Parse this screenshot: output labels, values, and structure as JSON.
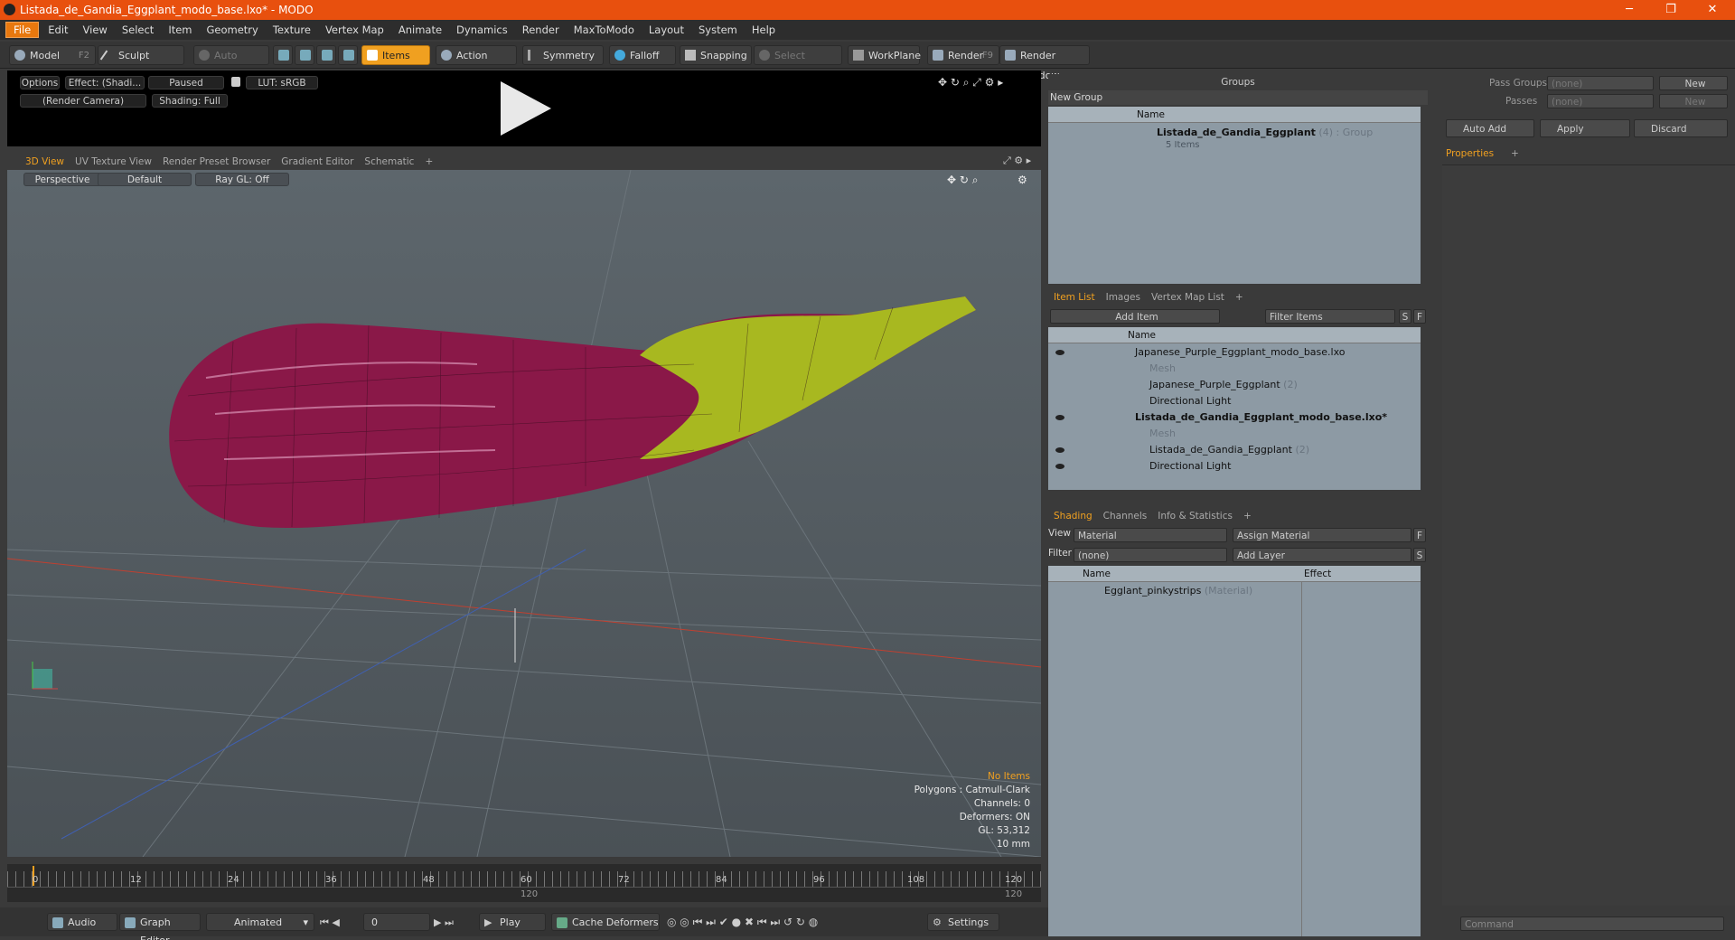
{
  "window": {
    "title": "Listada_de_Gandia_Eggplant_modo_base.lxo* - MODO",
    "min_glyph": "─",
    "max_glyph": "❐",
    "close_glyph": "✕"
  },
  "menu": [
    "File",
    "Edit",
    "View",
    "Select",
    "Item",
    "Geometry",
    "Texture",
    "Vertex Map",
    "Animate",
    "Dynamics",
    "Render",
    "MaxToModo",
    "Layout",
    "System",
    "Help"
  ],
  "toolbar": {
    "model": "Model",
    "model_key": "F2",
    "sculpt": "Sculpt",
    "auto_select": "Auto Select",
    "items": "Items",
    "action_center": "Action Center",
    "symmetry": "Symmetry",
    "falloff": "Falloff",
    "snapping": "Snapping",
    "select_through": "Select Through",
    "workplane": "WorkPlane",
    "render": "Render",
    "render_key": "F9",
    "render_window": "Render Window"
  },
  "preview": {
    "options": "Options",
    "effect": "Effect: (Shadi...",
    "paused": "Paused",
    "lut": "LUT: sRGB",
    "camera": "(Render Camera)",
    "shading": "Shading: Full"
  },
  "view_tabs": [
    "3D View",
    "UV Texture View",
    "Render Preset Browser",
    "Gradient Editor",
    "Schematic",
    "+"
  ],
  "viewport": {
    "perspective": "Perspective",
    "default": "Default",
    "raygl": "Ray GL: Off",
    "stats": {
      "items": "No Items",
      "polygons": "Polygons : Catmull-Clark",
      "channels": "Channels: 0",
      "deformers": "Deformers: ON",
      "gl": "GL: 53,312",
      "units": "10 mm"
    }
  },
  "timeline": {
    "ticks": [
      "0",
      "12",
      "24",
      "36",
      "48",
      "60",
      "72",
      "84",
      "96",
      "108",
      "120"
    ],
    "sub_left": "120",
    "sub_right": "120"
  },
  "bottom": {
    "audio": "Audio",
    "graph_editor": "Graph Editor",
    "animated": "Animated",
    "frame": "0",
    "play": "Play",
    "cache": "Cache Deformers",
    "settings": "Settings"
  },
  "groups": {
    "title": "Groups",
    "new_group": "New Group",
    "col_name": "Name",
    "item_name": "Listada_de_Gandia_Eggplant",
    "item_count": "(4)",
    "item_type": ": Group",
    "item_sub": "5 Items"
  },
  "itemlist": {
    "tabs": [
      "Item List",
      "Images",
      "Vertex Map List",
      "+"
    ],
    "add_item": "Add Item",
    "filter": "Filter Items",
    "s": "S",
    "f": "F",
    "col_name": "Name",
    "rows": [
      {
        "label": "Japanese_Purple_Eggplant_modo_base.lxo",
        "count": ""
      },
      {
        "label": "Mesh",
        "count": ""
      },
      {
        "label": "Japanese_Purple_Eggplant",
        "count": "(2)"
      },
      {
        "label": "Directional Light",
        "count": ""
      },
      {
        "label": "Listada_de_Gandia_Eggplant_modo_base.lxo*",
        "count": ""
      },
      {
        "label": "Mesh",
        "count": ""
      },
      {
        "label": "Listada_de_Gandia_Eggplant",
        "count": "(2)"
      },
      {
        "label": "Directional Light",
        "count": ""
      }
    ]
  },
  "shading": {
    "tabs": [
      "Shading",
      "Channels",
      "Info & Statistics",
      "+"
    ],
    "view_label": "View",
    "view_value": "Material",
    "assign": "Assign Material",
    "f": "F",
    "filter_label": "Filter",
    "filter_value": "(none)",
    "add_layer": "Add Layer",
    "s": "S",
    "col_name": "Name",
    "col_effect": "Effect",
    "row_name": "Egglant_pinkystrips",
    "row_type": "(Material)"
  },
  "right": {
    "pass_groups": "Pass Groups",
    "passes": "Passes",
    "none1": "(none)",
    "none2": "(none)",
    "new1": "New",
    "new2": "New",
    "auto_add": "Auto Add",
    "apply": "Apply",
    "discard": "Discard",
    "properties": "Properties",
    "plus": "+",
    "command": "Command"
  },
  "colors": {
    "accent": "#f0a020",
    "titlebar": "#e8500e",
    "eggplant": "#8a1848",
    "stem": "#a8b820"
  }
}
